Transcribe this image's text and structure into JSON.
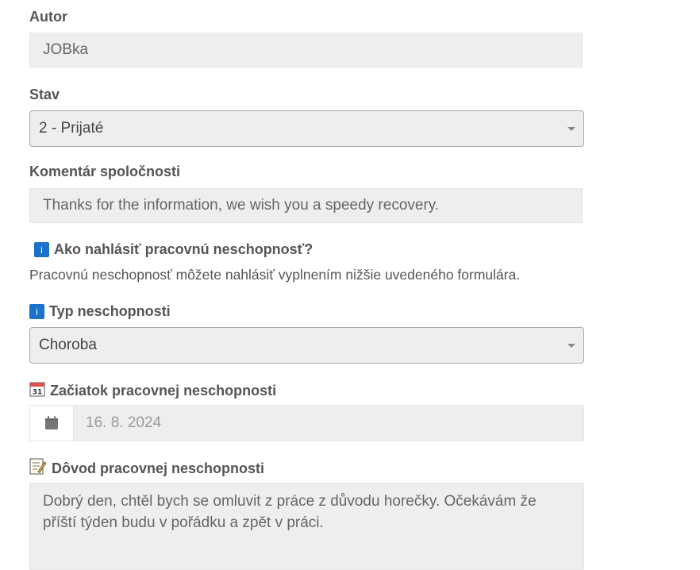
{
  "author": {
    "label": "Autor",
    "value": "JOBka"
  },
  "status": {
    "label": "Stav",
    "selected": "2 - Prijaté"
  },
  "company_comment": {
    "label": "Komentár spoločnosti",
    "value": "Thanks for the information, we wish you a speedy recovery."
  },
  "howto": {
    "title": "Ako nahlásiť pracovnú neschopnosť?",
    "text": "Pracovnú neschopnosť môžete nahlásiť vyplnením nižšie uvedeného formulára.",
    "icon": "info-icon"
  },
  "incapacity_type": {
    "label": "Typ neschopnosti",
    "selected": "Choroba",
    "icon": "info-icon"
  },
  "start_date": {
    "label": "Začiatok pracovnej neschopnosti",
    "value": "16. 8. 2024",
    "icon": "calendar-icon"
  },
  "reason": {
    "label": "Dôvod pracovnej neschopnosti",
    "value": "Dobrý den, chtěl bych se omluvit z práce z důvodu horečky. Očekávám že příští týden budu v pořádku a zpět v práci.",
    "icon": "memo-icon"
  },
  "colors": {
    "info_icon": "#1a73c9",
    "field_bg": "#eeeeee",
    "label_text": "#555555"
  }
}
